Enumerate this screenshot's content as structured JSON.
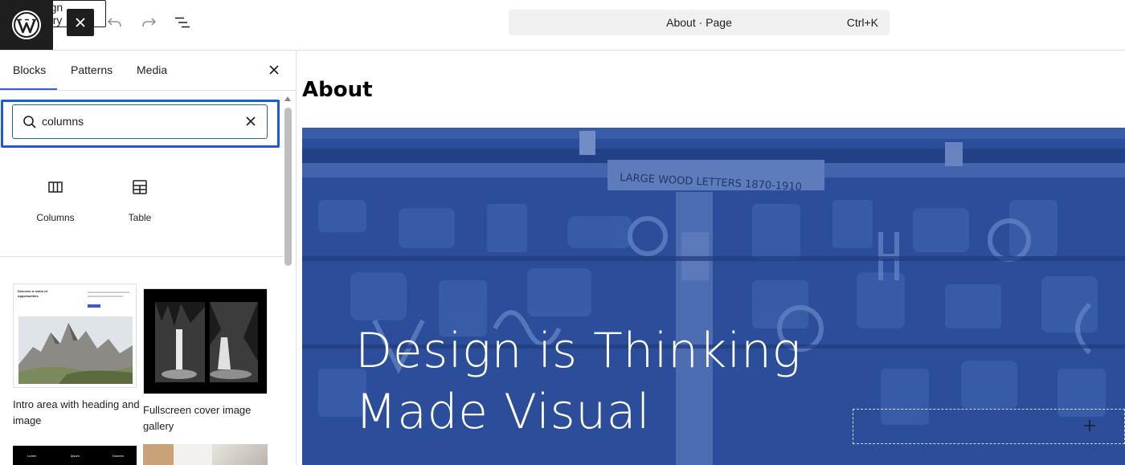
{
  "toolbar": {
    "design_library_label": "Design Library",
    "command_title": "About · Page",
    "command_shortcut": "Ctrl+K"
  },
  "sidebar": {
    "tabs": [
      {
        "label": "Blocks",
        "active": true
      },
      {
        "label": "Patterns",
        "active": false
      },
      {
        "label": "Media",
        "active": false
      }
    ],
    "search": {
      "value": "columns",
      "placeholder": "Search"
    },
    "blocks": [
      {
        "label": "Columns",
        "icon": "columns-icon"
      },
      {
        "label": "Table",
        "icon": "table-icon"
      }
    ],
    "patterns": [
      {
        "label": "Intro area with heading and image",
        "thumb_heading": "Discover a realm of opportunities."
      },
      {
        "label": "Fullscreen cover image gallery"
      },
      {
        "label_partial": "",
        "thumb_texts": [
          "Lorem",
          "Ipsum",
          "Dolores"
        ]
      }
    ]
  },
  "canvas": {
    "page_title": "About",
    "cover_heading": "Design is Thinking Made Visual",
    "cover_sign": "LARGE WOOD LETTERS 1870-1910"
  },
  "colors": {
    "accent": "#3858e9",
    "focus": "#1f5bd7",
    "cover_overlay": "#2a4d99",
    "dark": "#1e1e1e"
  }
}
